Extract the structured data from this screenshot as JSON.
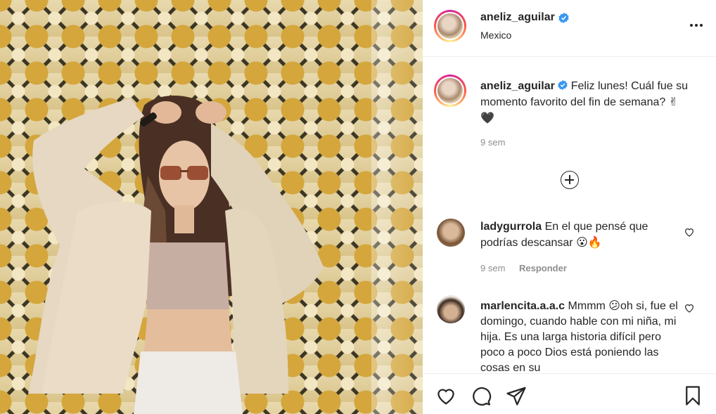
{
  "post": {
    "username": "aneliz_aguilar",
    "location": "Mexico",
    "caption": "Feliz lunes! Cuál fue su momento favorito del fin de semana?",
    "caption_emoji": "✌🖤",
    "caption_time": "9 sem"
  },
  "comments": [
    {
      "username": "ladygurrola",
      "text": "En el que pensé que podrías descansar",
      "emoji": "😮🔥",
      "time": "9 sem",
      "reply_label": "Responder"
    },
    {
      "username": "marlencita.a.a.c",
      "text_part1": "Mmmm",
      "emoji": "😕",
      "text_part2": "oh si, fue el domingo, cuando hable con mi niña, mi hija. Es una larga historia difícil pero poco a poco Dios está poniendo las cosas en su"
    }
  ],
  "colors": {
    "verified": "#3897f0",
    "muted": "#8e8e8e"
  },
  "icons": [
    "verified-badge-icon",
    "more-options-icon",
    "load-more-comments-icon",
    "like-icon",
    "comment-icon",
    "share-icon",
    "save-icon"
  ]
}
